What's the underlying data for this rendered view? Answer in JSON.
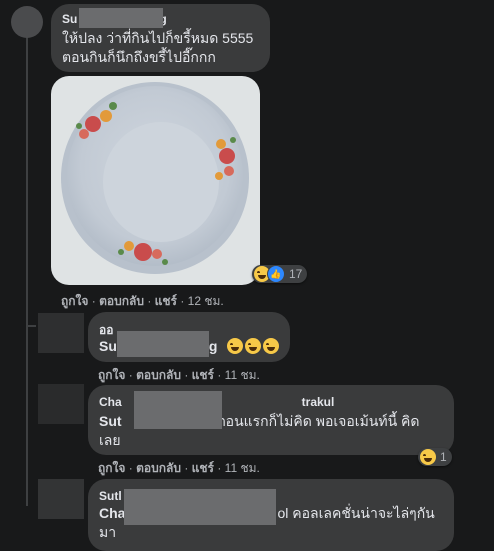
{
  "comments": [
    {
      "name_prefix": "Su",
      "name_suffix": "g",
      "text_line1": "ให้ปลง ว่าที่กินไปก็ขรี้หมด 5555",
      "text_line2": "ตอนกินก็นึกถึงขรี้ไปอี๊กกก",
      "reaction_count": "17",
      "like": "ถูกใจ",
      "reply": "ตอบกลับ",
      "share": "แชร์",
      "time": "12 ชม."
    },
    {
      "name_prefix": "ออ",
      "text_prefix": "Su",
      "text_suffix": "g",
      "like": "ถูกใจ",
      "reply": "ตอบกลับ",
      "share": "แชร์",
      "time": "11 ชม."
    },
    {
      "name_prefix": "Cha",
      "name_suffix": "trakul",
      "text_prefix1": "Sut",
      "text_suffix1": "ตอนแรกก็ไม่คิด พอเจอเม้นท์นี้ คิด",
      "text_line2": "เลย",
      "reaction_count": "1",
      "like": "ถูกใจ",
      "reply": "ตอบกลับ",
      "share": "แชร์",
      "time": "11 ชม."
    },
    {
      "name_prefix": "Sutl",
      "text_prefix1": "Cha",
      "text_suffix1": "ol คอลเลคชั่นน่าจะไล่ๆกัน",
      "text_line2": "มา"
    }
  ],
  "separator": "·",
  "colors": {
    "background": "#18191a",
    "bubble": "#3a3b3c",
    "text": "#e4e6eb",
    "secondary": "#b0b3b8",
    "laugh": "#f7c948",
    "like": "#2d88ff"
  },
  "icons": [
    "laugh-reaction-icon",
    "like-reaction-icon"
  ]
}
